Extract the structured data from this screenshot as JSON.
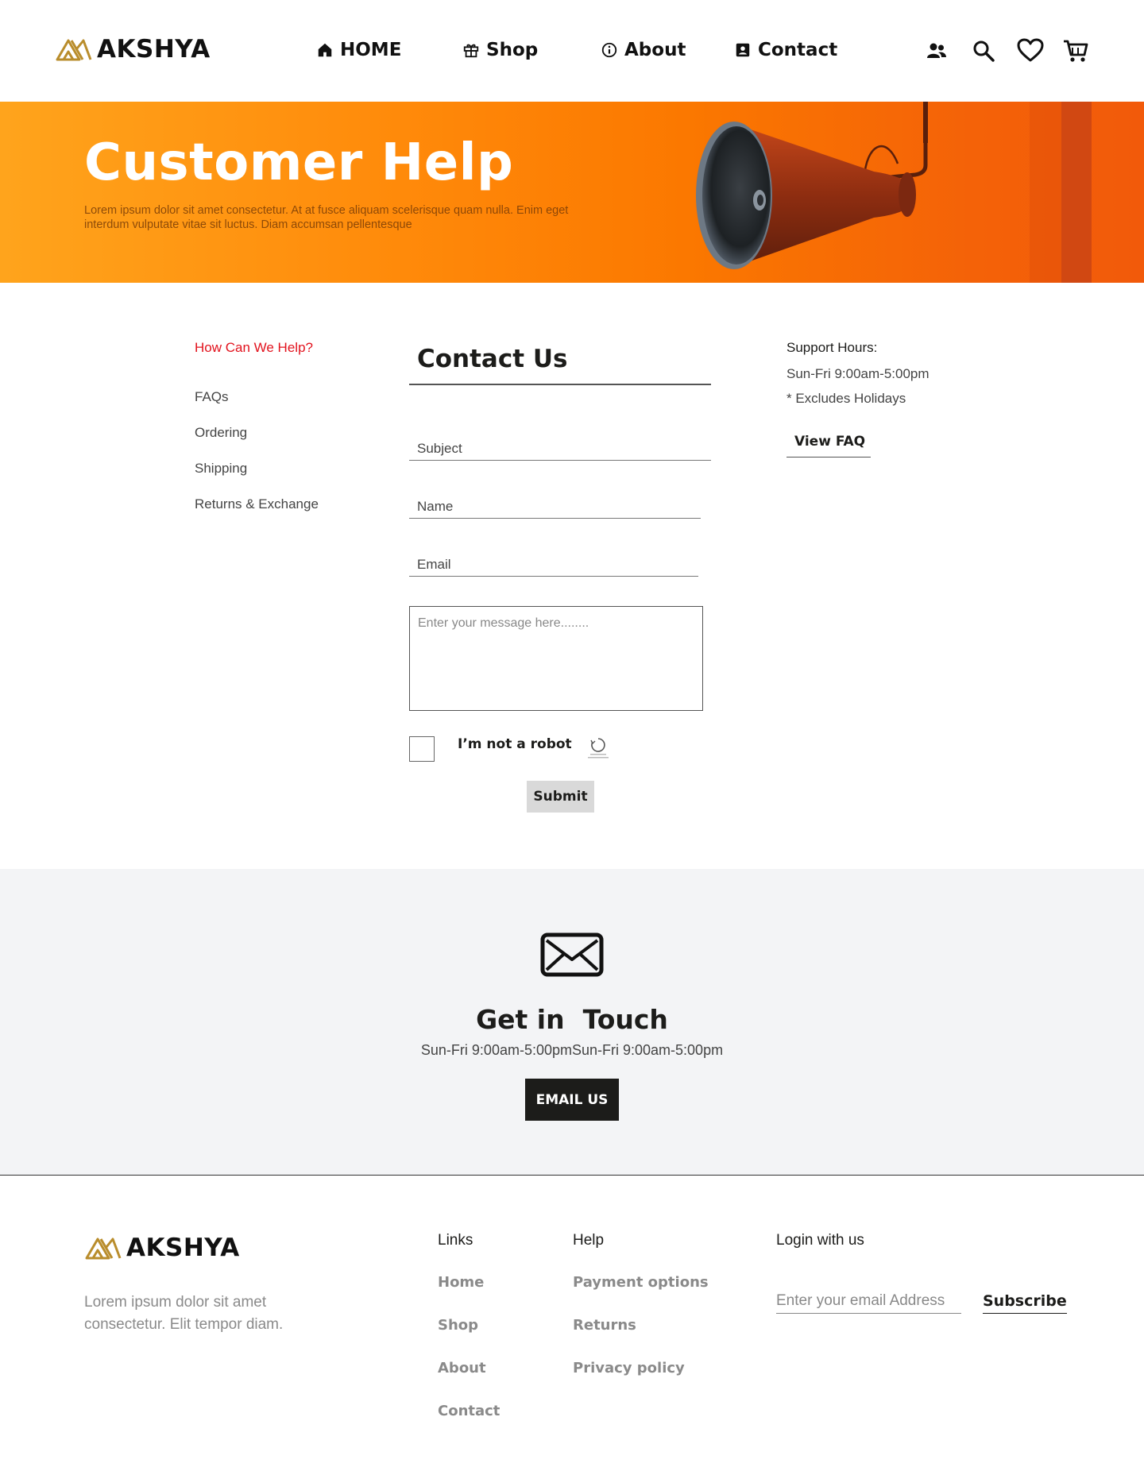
{
  "brand": {
    "name": "AKSHYA",
    "logo_icon": "mountain-logo-icon",
    "accent": "#b98d2c"
  },
  "header": {
    "nav": [
      {
        "label": "HOME",
        "icon": "home-icon"
      },
      {
        "label": "Shop",
        "icon": "gift-icon"
      },
      {
        "label": "About",
        "icon": "info-icon"
      },
      {
        "label": "Contact",
        "icon": "contact-card-icon"
      }
    ],
    "icons": [
      "users-icon",
      "search-icon",
      "heart-icon",
      "cart-icon"
    ]
  },
  "hero": {
    "title": "Customer Help",
    "subtitle": "Lorem ipsum dolor sit amet consectetur. At at fusce aliquam scelerisque quam nulla. Enim eget interdum vulputate vitae sit luctus. Diam accumsan pellentesque",
    "background_color": "#ff8a0a",
    "image": "megaphone-image"
  },
  "help": {
    "heading": "How Can We Help?",
    "heading_color": "#e2121d",
    "links": [
      "FAQs",
      "Ordering",
      "Shipping",
      "Returns & Exchange"
    ]
  },
  "contact_form": {
    "title": "Contact Us",
    "subject_placeholder": "Subject",
    "name_placeholder": "Name",
    "email_placeholder": "Email",
    "message_placeholder": "Enter your message here........",
    "captcha_label": "I’m not a robot",
    "submit_label": "Submit"
  },
  "support": {
    "title": "Support Hours:",
    "hours": "Sun-Fri 9:00am-5:00pm",
    "note": "* Excludes Holidays",
    "faq_link": "View FAQ"
  },
  "get_in_touch": {
    "icon": "envelope-icon",
    "title": "Get in  Touch",
    "hours": "Sun-Fri 9:00am-5:00pmSun-Fri 9:00am-5:00pm",
    "button_label": "EMAIL US"
  },
  "footer": {
    "description": "Lorem ipsum dolor sit amet consectetur. Elit tempor diam.",
    "links_title": "Links",
    "links": [
      "Home",
      "Shop",
      "About",
      "Contact"
    ],
    "help_title": "Help",
    "help_links": [
      "Payment options",
      "Returns",
      "Privacy policy"
    ],
    "login_title": "Login with us",
    "email_placeholder": "Enter your email Address",
    "subscribe_label": "Subscribe"
  }
}
